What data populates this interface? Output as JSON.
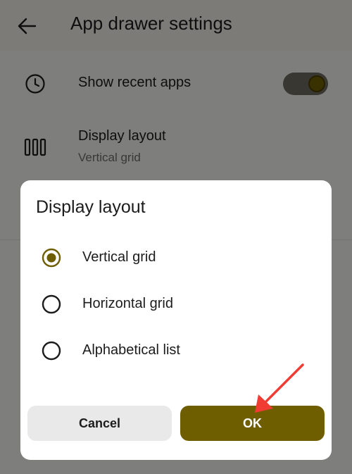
{
  "app_bar": {
    "title": "App drawer settings",
    "back_icon": "arrow-left-icon"
  },
  "settings": {
    "show_recent": {
      "title": "Show recent apps",
      "icon": "clock-icon",
      "enabled": true
    },
    "display_layout": {
      "title": "Display layout",
      "subtitle": "Vertical grid",
      "icon": "columns-icon"
    }
  },
  "dialog": {
    "title": "Display layout",
    "options": [
      {
        "label": "Vertical grid",
        "selected": true
      },
      {
        "label": "Horizontal grid",
        "selected": false
      },
      {
        "label": "Alphabetical list",
        "selected": false
      }
    ],
    "cancel_label": "Cancel",
    "ok_label": "OK"
  },
  "colors": {
    "accent": "#6e5e00",
    "annotation_arrow": "#f03c32"
  }
}
